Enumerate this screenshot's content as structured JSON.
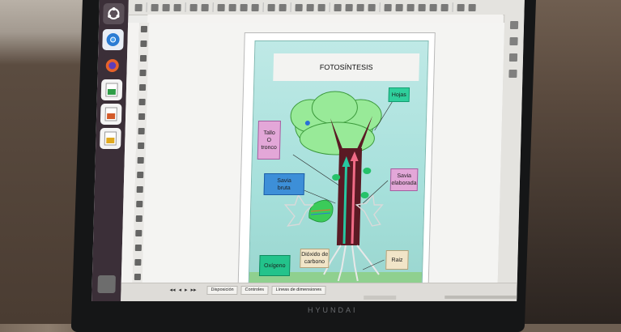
{
  "monitor": {
    "brand": "HYUNDAI"
  },
  "launcher": {
    "items": [
      {
        "icon": "ubuntu-dash-icon",
        "color": "#5a4f57"
      },
      {
        "icon": "chromium-icon",
        "color": "#2b7cd3"
      },
      {
        "icon": "firefox-icon",
        "color": "#e6622a"
      },
      {
        "icon": "libreoffice-calc-icon",
        "color": "#2e9d47"
      },
      {
        "icon": "libreoffice-impress-icon",
        "color": "#d35b2a"
      },
      {
        "icon": "libreoffice-draw-icon",
        "color": "#e0a91f"
      }
    ]
  },
  "poster": {
    "title": "FOTOSÍNTESIS",
    "labels": {
      "hojas": "Hojas",
      "tallo": "Tallo\nO\ntronco",
      "savia_bruta": "Savia\nbruta",
      "savia_elaborada": "Savia\nelaborada",
      "dioxido": "Dióxido de\ncarbono",
      "oxigeno": "Oxígeno",
      "raiz": "Raiz"
    },
    "colors": {
      "hojas": "#2fcf9c",
      "tallo": "#e3a7d8",
      "savia_bruta": "#3d8fd8",
      "savia_elaborada": "#e3a7d8",
      "dioxido": "#f1e5c8",
      "oxigeno": "#23c38b",
      "raiz": "#f1e5c8",
      "trunk": "#5a1a24",
      "canopy": "#98ea98"
    }
  },
  "statusbar": {
    "tabs": [
      "Disposición",
      "Controles",
      "Líneas de dimensiones"
    ]
  }
}
